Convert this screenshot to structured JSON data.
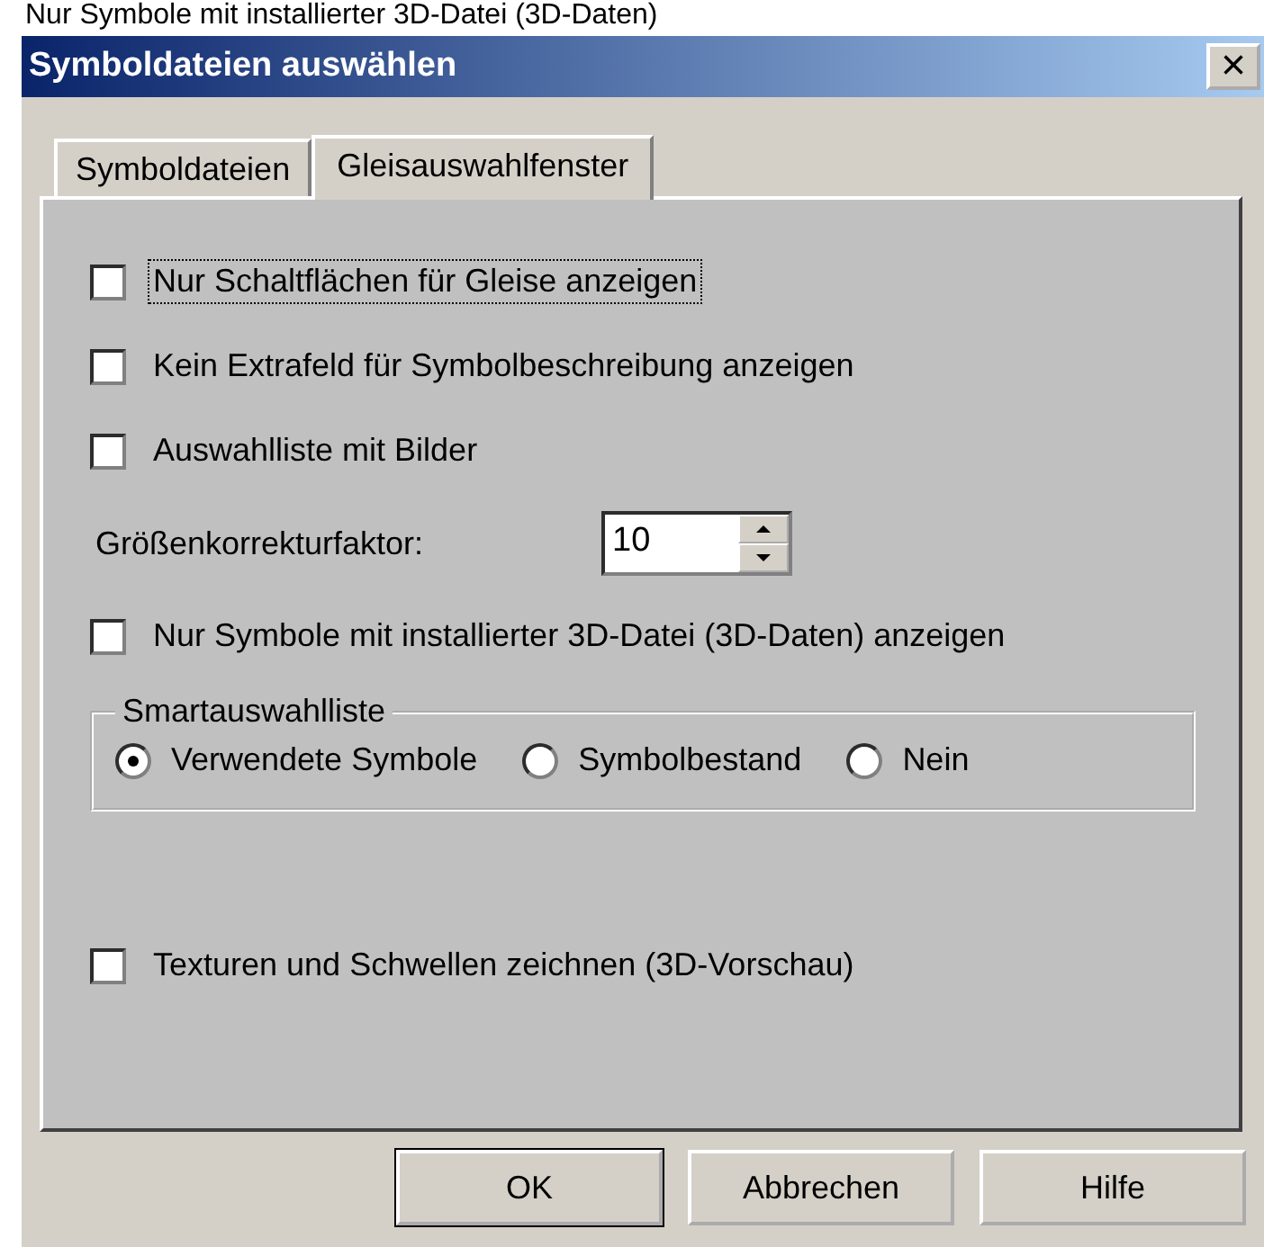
{
  "caption_above": "Nur Symbole mit installierter 3D-Datei (3D-Daten)",
  "window": {
    "title": "Symboldateien auswählen",
    "close": "×"
  },
  "tabs": [
    {
      "label": "Symboldateien",
      "selected": false
    },
    {
      "label": "Gleisauswahlfenster",
      "selected": true
    }
  ],
  "options": [
    {
      "kind": "checkbox",
      "label": "Nur Schaltflächen für Gleise anzeigen",
      "checked": false,
      "focused": true
    },
    {
      "kind": "checkbox",
      "label": "Kein Extrafeld für Symbolbeschreibung anzeigen",
      "checked": false,
      "focused": false
    },
    {
      "kind": "checkbox",
      "label": "Auswahlliste mit Bilder",
      "checked": false,
      "focused": false
    },
    {
      "kind": "spinner",
      "label": "Größenkorrekturfaktor:",
      "value": "10"
    },
    {
      "kind": "checkbox",
      "label": "Nur Symbole mit installierter 3D-Datei (3D-Daten) anzeigen",
      "checked": false,
      "focused": false
    },
    {
      "kind": "group",
      "label": "Smartauswahlliste",
      "radios": [
        {
          "label": "Verwendete Symbole",
          "selected": true
        },
        {
          "label": "Symbolbestand",
          "selected": false
        },
        {
          "label": "Nein",
          "selected": false
        }
      ]
    },
    {
      "kind": "spacer"
    },
    {
      "kind": "checkbox",
      "label": "Texturen und Schwellen zeichnen (3D-Vorschau)",
      "checked": false,
      "focused": false
    }
  ],
  "buttons": [
    {
      "label": "OK",
      "default": true
    },
    {
      "label": "Abbrechen",
      "default": false
    },
    {
      "label": "Hilfe",
      "default": false
    }
  ]
}
